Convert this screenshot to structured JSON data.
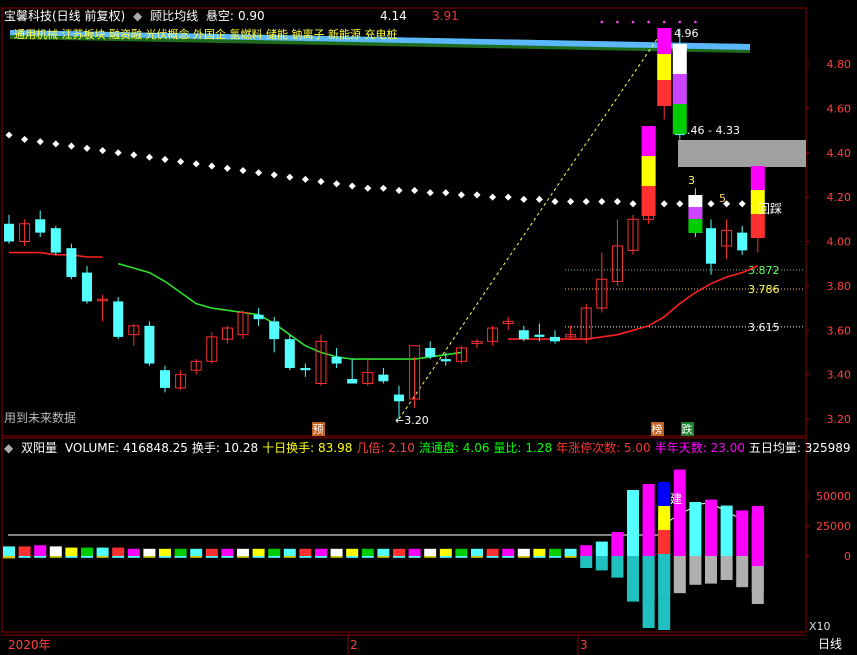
{
  "top_header": {
    "stock": "宝馨科技(日线 前复权)",
    "indicator": "顾比均线",
    "suspend_label": "悬空:",
    "suspend_value": "0.90",
    "value_a": "4.14",
    "value_b": "3.91"
  },
  "concepts_text": "通用机械  江苏板块  融资融  光伏概念  外国企  氢燃料  储能  钠离子  新能源  充电桩",
  "future_data_label": "用到未来数据",
  "main_price_labels": {
    "high": "4.96",
    "low": "3.20",
    "range": "4.46 - 4.33",
    "level1": "3.872",
    "level2": "3.786",
    "level3": "3.615",
    "num3": "3",
    "num5": "5",
    "callback": "回踩"
  },
  "markers": {
    "yu": "预",
    "bang": "榜",
    "die": "跌",
    "jian": "建"
  },
  "volume_header": {
    "title": "双阳量",
    "items": [
      {
        "label": "VOLUME:",
        "value": "416848.25",
        "color": "#ffffff"
      },
      {
        "label": "换手:",
        "value": "10.28",
        "color": "#ffffff"
      },
      {
        "label": "十日换手:",
        "value": "83.98",
        "color": "#ffff00"
      },
      {
        "label": "几倍:",
        "value": "2.10",
        "color": "#ff4040"
      },
      {
        "label": "流通盘:",
        "value": "4.06",
        "color": "#00ff00"
      },
      {
        "label": "量比:",
        "value": "1.28",
        "color": "#00ff00"
      },
      {
        "label": "年涨停次数:",
        "value": "5.00",
        "color": "#ff3030"
      },
      {
        "label": "半年天数:",
        "value": "23.00",
        "color": "#ff00ff"
      },
      {
        "label": "五日均量:",
        "value": "325989",
        "color": "#ffffff"
      }
    ]
  },
  "x10_label": "X10",
  "bottom_bar": {
    "year": "2020年",
    "m2": "2",
    "m3": "3",
    "period": "日线"
  },
  "colors": {
    "up": "#ff3030",
    "down": "#54ffff",
    "grid": "#8b0000"
  },
  "chart_data": [
    {
      "type": "candlestick",
      "y_ticks": [
        "4.80",
        "4.60",
        "4.40",
        "4.20",
        "4.00",
        "3.80",
        "3.60",
        "3.40",
        "3.20"
      ],
      "ylim": [
        3.12,
        5.0
      ],
      "candles": [
        {
          "o": 4.08,
          "h": 4.12,
          "l": 3.99,
          "c": 4.0
        },
        {
          "o": 4.0,
          "h": 4.1,
          "l": 3.98,
          "c": 4.08
        },
        {
          "o": 4.1,
          "h": 4.14,
          "l": 4.02,
          "c": 4.04
        },
        {
          "o": 4.06,
          "h": 4.07,
          "l": 3.94,
          "c": 3.95
        },
        {
          "o": 3.97,
          "h": 3.99,
          "l": 3.83,
          "c": 3.84
        },
        {
          "o": 3.86,
          "h": 3.89,
          "l": 3.72,
          "c": 3.73
        },
        {
          "o": 3.74,
          "h": 3.76,
          "l": 3.64,
          "c": 3.74
        },
        {
          "o": 3.73,
          "h": 3.75,
          "l": 3.56,
          "c": 3.57
        },
        {
          "o": 3.58,
          "h": 3.63,
          "l": 3.53,
          "c": 3.62
        },
        {
          "o": 3.62,
          "h": 3.64,
          "l": 3.44,
          "c": 3.45
        },
        {
          "o": 3.42,
          "h": 3.44,
          "l": 3.32,
          "c": 3.34
        },
        {
          "o": 3.34,
          "h": 3.42,
          "l": 3.33,
          "c": 3.4
        },
        {
          "o": 3.42,
          "h": 3.47,
          "l": 3.4,
          "c": 3.46
        },
        {
          "o": 3.46,
          "h": 3.59,
          "l": 3.45,
          "c": 3.57
        },
        {
          "o": 3.56,
          "h": 3.62,
          "l": 3.54,
          "c": 3.61
        },
        {
          "o": 3.58,
          "h": 3.69,
          "l": 3.56,
          "c": 3.68
        },
        {
          "o": 3.67,
          "h": 3.7,
          "l": 3.62,
          "c": 3.65
        },
        {
          "o": 3.64,
          "h": 3.66,
          "l": 3.5,
          "c": 3.56
        },
        {
          "o": 3.56,
          "h": 3.58,
          "l": 3.42,
          "c": 3.43
        },
        {
          "o": 3.43,
          "h": 3.45,
          "l": 3.39,
          "c": 3.42
        },
        {
          "o": 3.36,
          "h": 3.58,
          "l": 3.35,
          "c": 3.55
        },
        {
          "o": 3.48,
          "h": 3.52,
          "l": 3.43,
          "c": 3.45
        },
        {
          "o": 3.38,
          "h": 3.47,
          "l": 3.36,
          "c": 3.36
        },
        {
          "o": 3.36,
          "h": 3.47,
          "l": 3.35,
          "c": 3.41
        },
        {
          "o": 3.4,
          "h": 3.43,
          "l": 3.36,
          "c": 3.37
        },
        {
          "o": 3.31,
          "h": 3.35,
          "l": 3.2,
          "c": 3.28
        },
        {
          "o": 3.29,
          "h": 3.48,
          "l": 3.25,
          "c": 3.53
        },
        {
          "o": 3.52,
          "h": 3.55,
          "l": 3.47,
          "c": 3.48
        },
        {
          "o": 3.47,
          "h": 3.5,
          "l": 3.44,
          "c": 3.46
        },
        {
          "o": 3.46,
          "h": 3.53,
          "l": 3.45,
          "c": 3.52
        },
        {
          "o": 3.54,
          "h": 3.56,
          "l": 3.52,
          "c": 3.55
        },
        {
          "o": 3.55,
          "h": 3.62,
          "l": 3.53,
          "c": 3.61
        },
        {
          "o": 3.63,
          "h": 3.66,
          "l": 3.6,
          "c": 3.64
        },
        {
          "o": 3.6,
          "h": 3.62,
          "l": 3.55,
          "c": 3.56
        },
        {
          "o": 3.58,
          "h": 3.63,
          "l": 3.55,
          "c": 3.57
        },
        {
          "o": 3.57,
          "h": 3.6,
          "l": 3.54,
          "c": 3.55
        },
        {
          "o": 3.57,
          "h": 3.62,
          "l": 3.56,
          "c": 3.58
        },
        {
          "o": 3.56,
          "h": 3.72,
          "l": 3.54,
          "c": 3.7
        },
        {
          "o": 3.7,
          "h": 3.95,
          "l": 3.68,
          "c": 3.83
        },
        {
          "o": 3.82,
          "h": 4.1,
          "l": 3.8,
          "c": 3.98
        },
        {
          "o": 3.96,
          "h": 4.12,
          "l": 3.94,
          "c": 4.1
        },
        {
          "o": 4.1,
          "h": 4.38,
          "l": 4.08,
          "c": 4.36
        },
        {
          "o": 4.66,
          "h": 4.96,
          "l": 4.55,
          "c": 4.96
        },
        {
          "o": 4.88,
          "h": 4.96,
          "l": 4.46,
          "c": 4.48
        },
        {
          "o": 4.2,
          "h": 4.24,
          "l": 4.02,
          "c": 4.06
        },
        {
          "o": 4.06,
          "h": 4.1,
          "l": 3.85,
          "c": 3.9
        },
        {
          "o": 3.98,
          "h": 4.1,
          "l": 3.92,
          "c": 4.05
        },
        {
          "o": 4.04,
          "h": 4.07,
          "l": 3.94,
          "c": 3.96
        },
        {
          "o": 4.04,
          "h": 4.24,
          "l": 3.95,
          "c": 4.14
        }
      ],
      "ma_red": [
        3.95,
        3.95,
        3.95,
        3.94,
        3.94,
        3.93,
        3.93,
        null,
        null,
        null,
        null,
        null,
        null,
        null,
        null,
        null,
        null,
        null,
        null,
        null,
        null,
        null,
        null,
        null,
        null,
        null,
        null,
        null,
        null,
        null,
        null,
        null,
        3.56,
        3.56,
        3.56,
        3.56,
        3.56,
        3.56,
        3.57,
        3.58,
        3.6,
        3.62,
        3.66,
        3.72,
        3.77,
        3.81,
        3.84,
        3.86,
        3.89
      ],
      "ma_green": [
        null,
        null,
        null,
        null,
        null,
        null,
        null,
        3.9,
        3.88,
        3.86,
        3.82,
        3.77,
        3.72,
        3.7,
        3.69,
        3.68,
        3.67,
        3.63,
        3.58,
        3.53,
        3.5,
        3.48,
        3.47,
        3.47,
        3.47,
        3.47,
        3.47,
        3.48,
        3.49,
        3.5,
        null,
        null,
        null,
        null,
        null,
        null,
        null,
        null,
        null,
        null,
        null,
        null,
        null,
        null,
        null,
        null,
        null,
        null,
        null
      ],
      "white_dots": [
        4.48,
        4.46,
        4.45,
        4.44,
        4.43,
        4.42,
        4.41,
        4.4,
        4.39,
        4.38,
        4.37,
        4.36,
        4.35,
        4.34,
        4.33,
        4.32,
        4.31,
        4.3,
        4.29,
        4.28,
        4.27,
        4.26,
        4.25,
        4.24,
        4.24,
        4.23,
        4.23,
        4.22,
        4.22,
        4.21,
        4.21,
        4.2,
        4.2,
        4.19,
        4.19,
        4.18,
        4.18,
        4.18,
        4.18,
        4.18,
        4.17,
        4.17,
        4.17,
        4.17,
        4.17,
        4.17,
        4.17,
        4.17,
        4.17
      ],
      "levels": [
        3.872,
        3.786,
        3.615
      ],
      "range_box": [
        4.46,
        4.33
      ]
    },
    {
      "type": "bar",
      "name": "双阳量",
      "y_ticks": [
        "50000",
        "25000",
        "0"
      ],
      "ylim": [
        -60000,
        75000
      ],
      "bars_top": [
        8000,
        8000,
        9000,
        8000,
        7000,
        7000,
        7000,
        7000,
        6000,
        6000,
        6000,
        6000,
        6000,
        6000,
        6000,
        6000,
        6000,
        6000,
        6000,
        6000,
        6000,
        6000,
        6000,
        6000,
        6000,
        6000,
        6000,
        6000,
        6000,
        6000,
        6000,
        6000,
        6000,
        6000,
        6000,
        6000,
        6000,
        9000,
        12000,
        20000,
        55000,
        60000,
        35000,
        72000,
        45000,
        47000,
        42000,
        38000,
        35000,
        42000,
        30000,
        43000
      ],
      "bars_bottom": [
        2000,
        1500,
        1500,
        1500,
        1500,
        1500,
        1500,
        1500,
        1500,
        1500,
        1500,
        1500,
        1500,
        1500,
        1500,
        1500,
        1500,
        1500,
        1500,
        1500,
        1500,
        1500,
        1500,
        1500,
        1500,
        1500,
        1500,
        1500,
        1500,
        1500,
        1500,
        1500,
        1500,
        1500,
        1500,
        1500,
        1500,
        10000,
        12000,
        18000,
        38000,
        60000,
        33000,
        31000,
        24000,
        23000,
        20000,
        26000,
        30000,
        0,
        0,
        0
      ]
    }
  ]
}
